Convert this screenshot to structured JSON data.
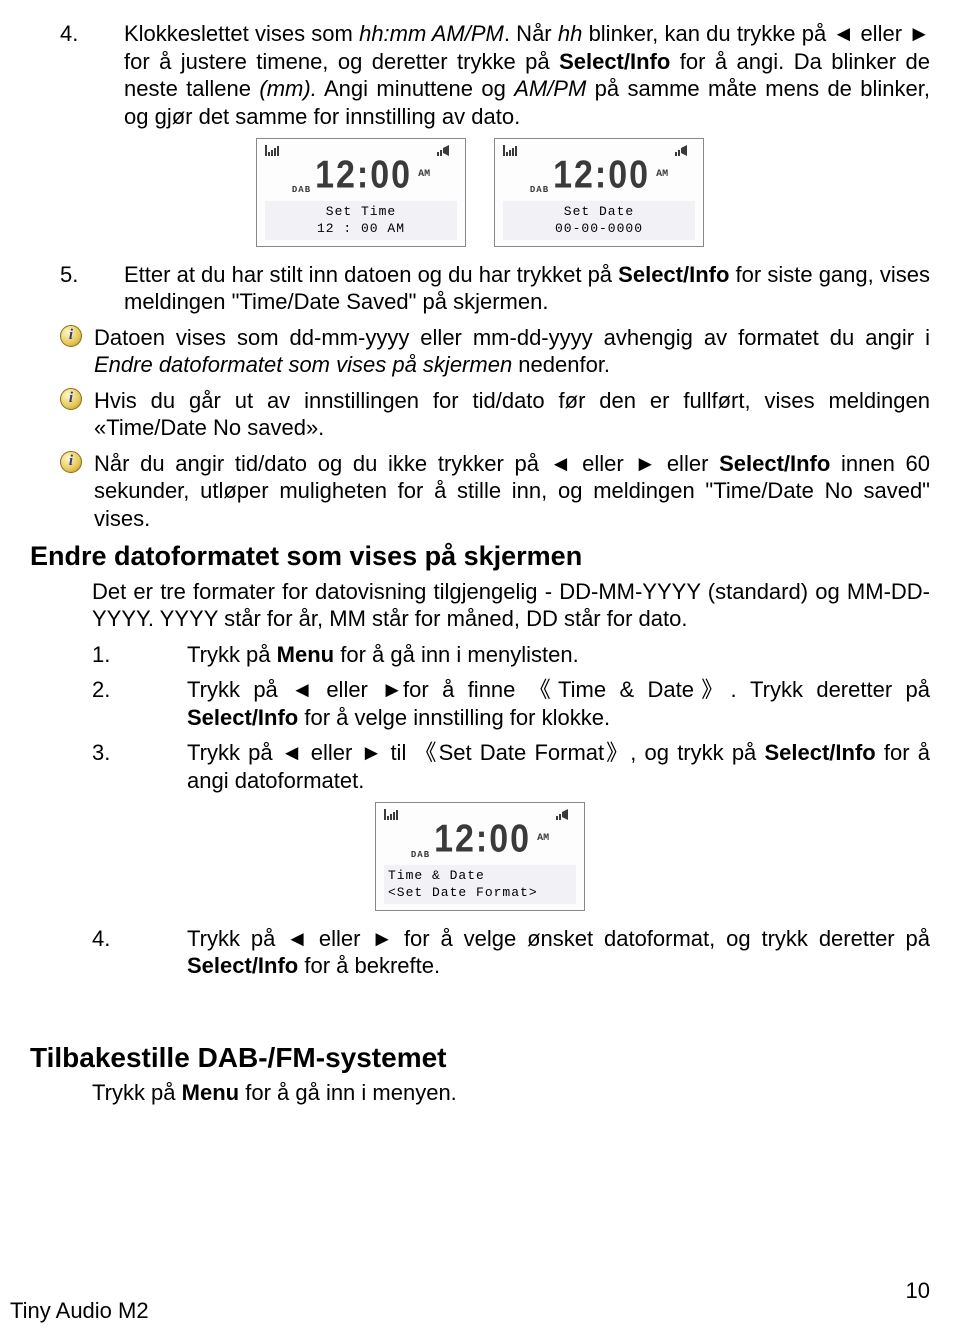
{
  "step4": {
    "num": "4.",
    "text_a": "Klokkeslettet vises som ",
    "italic_a": "hh:mm AM/PM",
    "text_b": ". Når ",
    "italic_b": "hh",
    "text_c": " blinker, kan du trykke på ◄ eller ► for å justere timene, og deretter trykke på ",
    "bold_a": "Select/Info",
    "text_d": " for å angi. Da blinker de neste tallene ",
    "italic_c": "(mm).",
    "text_e": " Angi minuttene og ",
    "italic_d": "AM/PM",
    "text_f": " på samme måte mens de blinker, og gjør det samme for innstilling av dato."
  },
  "lcd1": {
    "line1": "Set Time",
    "line2": "12 : 00 AM",
    "digits": "12:00",
    "ampm": "AM",
    "dab": "DAB"
  },
  "lcd2": {
    "line1": "Set Date",
    "line2": "00-00-0000",
    "digits": "12:00",
    "ampm": "AM",
    "dab": "DAB"
  },
  "step5": {
    "num": "5.",
    "text_a": "Etter at du har stilt inn datoen og du har trykket på ",
    "bold_a": "Select/Info",
    "text_b": " for siste gang, vises meldingen \"Time/Date Saved\" på skjermen."
  },
  "info1": {
    "text_a": "Datoen vises som dd-mm-yyyy eller mm-dd-yyyy avhengig av formatet du angir i ",
    "italic_a": "Endre datoformatet som vises på skjermen",
    "text_b": " nedenfor."
  },
  "info2": {
    "text_a": "Hvis du går ut av innstillingen for tid/dato før den er fullført, vises meldingen «Time/Date No saved»."
  },
  "info3": {
    "text_a": "Når du angir tid/dato og du ikke trykker på ◄ eller ► eller ",
    "bold_a": "Select/Info",
    "text_b": " innen 60 sekunder, utløper muligheten for å stille inn, og meldingen \"Time/Date No saved\" vises."
  },
  "heading2": "Endre datoformatet som vises på skjermen",
  "formats_intro": "Det er tre formater for datovisning tilgjengelig - DD-MM-YYYY (standard) og MM-DD-YYYY. YYYY står for år, MM står for måned, DD står for dato.",
  "sub1": {
    "num": "1.",
    "a": "Trykk på ",
    "bold": "Menu",
    "b": " for å gå inn i menylisten."
  },
  "sub2": {
    "num": "2.",
    "a": "Trykk på ◄ eller ►for å finne 《Time & Date》. Trykk deretter på ",
    "bold": "Select/Info",
    "b": " for å velge innstilling for klokke."
  },
  "sub3": {
    "num": "3.",
    "a": "Trykk på ◄ eller ► til 《Set Date Format》, og trykk på ",
    "bold": "Select/Info",
    "b": " for å angi datoformatet."
  },
  "lcd3": {
    "line1": "Time & Date",
    "line2": "<Set Date Format>",
    "digits": "12:00",
    "ampm": "AM",
    "dab": "DAB"
  },
  "sub4": {
    "num": "4.",
    "a": "Trykk på ◄ eller ► for å velge ønsket datoformat, og trykk deretter på ",
    "bold": "Select/Info",
    "b": " for å bekrefte."
  },
  "heading3": "Tilbakestille DAB-/FM-systemet",
  "reset": {
    "a": "Trykk på ",
    "bold": "Menu",
    "b": " for å gå inn i menyen."
  },
  "footer_left": "Tiny Audio M2",
  "footer_right": "10"
}
